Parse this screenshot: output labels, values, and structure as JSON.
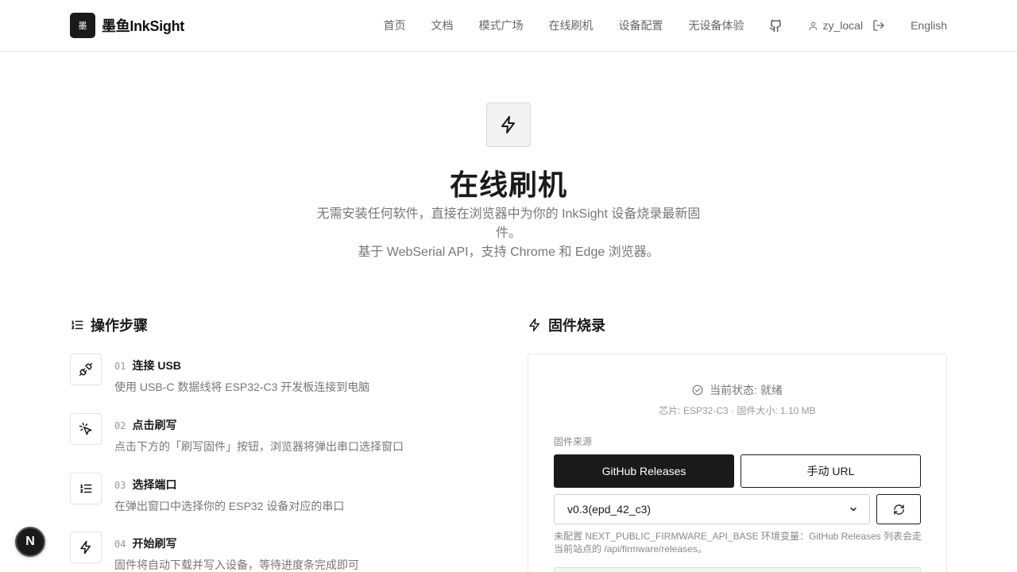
{
  "brand": {
    "logo_glyph": "墨",
    "name": "墨鱼InkSight"
  },
  "nav": {
    "items": [
      "首页",
      "文档",
      "模式广场",
      "在线刷机",
      "设备配置",
      "无设备体验"
    ],
    "github_icon": "github-icon",
    "username": "zy_local",
    "language": "English"
  },
  "hero": {
    "title": "在线刷机",
    "desc_line1": "无需安装任何软件，直接在浏览器中为你的 InkSight 设备烧录最新固件。",
    "desc_line2": "基于 WebSerial API，支持 Chrome 和 Edge 浏览器。"
  },
  "steps_section": {
    "title": "操作步骤",
    "steps": [
      {
        "num": "01",
        "title": "连接 USB",
        "desc": "使用 USB-C 数据线将 ESP32-C3 开发板连接到电脑",
        "icon": "plug-icon"
      },
      {
        "num": "02",
        "title": "点击刷写",
        "desc": "点击下方的「刷写固件」按钮，浏览器将弹出串口选择窗口",
        "icon": "pointer-click-icon"
      },
      {
        "num": "03",
        "title": "选择端口",
        "desc": "在弹出窗口中选择你的 ESP32 设备对应的串口",
        "icon": "list-icon"
      },
      {
        "num": "04",
        "title": "开始刷写",
        "desc": "固件将自动下载并写入设备，等待进度条完成即可",
        "icon": "lightning-icon"
      }
    ]
  },
  "flash_section": {
    "title": "固件烧录",
    "status": "当前状态: 就绪",
    "chip_info": "芯片: ESP32-C3 · 固件大小: 1.10 MB",
    "source_label": "固件来源",
    "btn_github": "GitHub Releases",
    "btn_manual": "手动 URL",
    "selected_version": "v0.3(epd_42_c3)",
    "note": "未配置 NEXT_PUBLIC_FIRMWARE_API_BASE 环境变量：GitHub Releases 列表会走当前站点的 /api/firmware/releases。"
  },
  "badge": {
    "letter": "N"
  },
  "colors": {
    "dark": "#1a1a1a",
    "muted": "#777777",
    "border": "#e8e8e8",
    "success_bg": "#eafaf0"
  }
}
